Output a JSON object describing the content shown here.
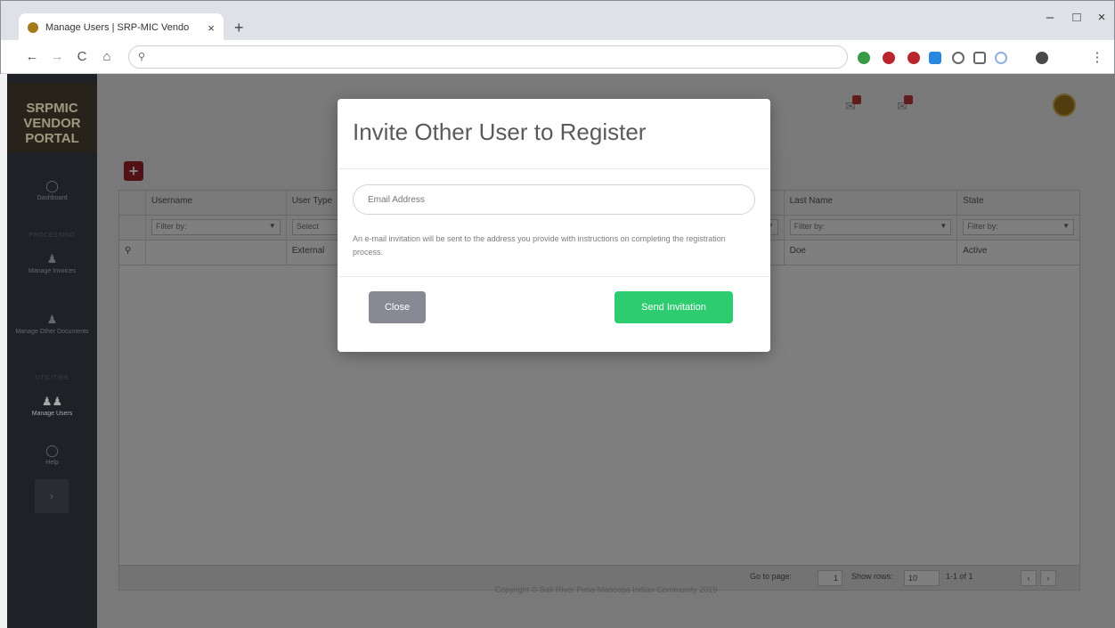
{
  "browser": {
    "tab_title": "Manage Users | SRP-MIC Vendo",
    "tab_close": "×",
    "new_tab": "+",
    "minimize": "–",
    "maximize": "□",
    "close": "×",
    "back": "←",
    "forward": "→",
    "reload": "C",
    "home": "⌂",
    "omnibox_value": "",
    "omnibox_icon": "search-icon",
    "menu": "⋮"
  },
  "sidebar": {
    "logo_lines": [
      "SRPMIC",
      "VENDOR",
      "PORTAL"
    ],
    "items": [
      {
        "label": "Dashboard",
        "icon": "dashboard-icon"
      },
      {
        "section": "PROCESSING"
      },
      {
        "label": "Manage Invoices",
        "icon": "person-icon"
      },
      {
        "label": "Manage Other Documents",
        "icon": "person-icon"
      },
      {
        "section": "UTILITIES"
      },
      {
        "label": "Manage Users",
        "icon": "users-icon"
      },
      {
        "label": "Help",
        "icon": "help-icon"
      }
    ],
    "collapse": "›"
  },
  "grid": {
    "add_icon": "+",
    "columns": [
      "Username",
      "User Type",
      "Last Name",
      "State"
    ],
    "filters": [
      "Filter by:",
      "Select",
      "Filter by:",
      "Filter by:"
    ],
    "row": [
      "",
      "External",
      "Doe",
      "Active"
    ],
    "pager": {
      "goto_label": "Go to page:",
      "goto_value": "1",
      "rows_label": "Show rows:",
      "rows_value": "10",
      "range": "1-1 of 1",
      "prev": "‹",
      "next": "›"
    }
  },
  "footer": "Copyright © Salt River Pima-Maricopa Indian Community 2019",
  "modal": {
    "title": "Invite Other User to Register",
    "email_placeholder": "Email Address",
    "help_text": "An e-mail invitation will be sent to the address you provide with instructions on completing the registration process.",
    "close_label": "Close",
    "send_label": "Send Invitation"
  },
  "colors": {
    "accent_red": "#a2222d",
    "send_green": "#2ecc71",
    "close_gray": "#878a94",
    "sidebar": "#2f343a"
  }
}
